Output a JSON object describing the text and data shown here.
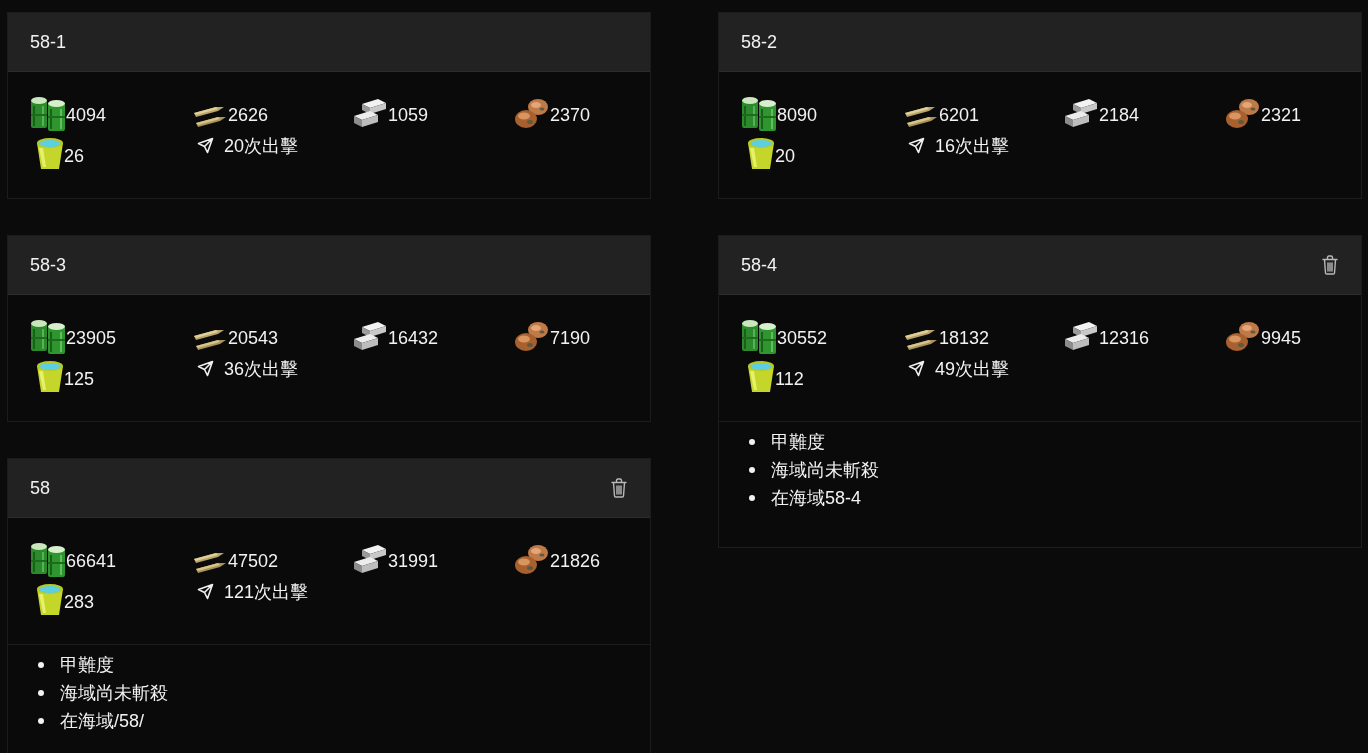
{
  "cards": [
    {
      "title": "58-1",
      "deletable": false,
      "resources": [
        {
          "kind": "fuel",
          "amount": "4094"
        },
        {
          "kind": "ammo",
          "amount": "2626"
        },
        {
          "kind": "steel",
          "amount": "1059"
        },
        {
          "kind": "bauxite",
          "amount": "2370"
        },
        {
          "kind": "bucket",
          "amount": "26"
        }
      ],
      "sorties": "20次出擊"
    },
    {
      "title": "58-2",
      "deletable": false,
      "resources": [
        {
          "kind": "fuel",
          "amount": "8090"
        },
        {
          "kind": "ammo",
          "amount": "6201"
        },
        {
          "kind": "steel",
          "amount": "2184"
        },
        {
          "kind": "bauxite",
          "amount": "2321"
        },
        {
          "kind": "bucket",
          "amount": "20"
        }
      ],
      "sorties": "16次出擊"
    },
    {
      "title": "58-3",
      "deletable": false,
      "resources": [
        {
          "kind": "fuel",
          "amount": "23905"
        },
        {
          "kind": "ammo",
          "amount": "20543"
        },
        {
          "kind": "steel",
          "amount": "16432"
        },
        {
          "kind": "bauxite",
          "amount": "7190"
        },
        {
          "kind": "bucket",
          "amount": "125"
        }
      ],
      "sorties": "36次出擊"
    },
    {
      "title": "58-4",
      "deletable": true,
      "resources": [
        {
          "kind": "fuel",
          "amount": "30552"
        },
        {
          "kind": "ammo",
          "amount": "18132"
        },
        {
          "kind": "steel",
          "amount": "12316"
        },
        {
          "kind": "bauxite",
          "amount": "9945"
        },
        {
          "kind": "bucket",
          "amount": "112"
        }
      ],
      "sorties": "49次出擊",
      "notes": [
        "甲難度",
        "海域尚未斬殺",
        "在海域58-4"
      ]
    },
    {
      "title": "58",
      "deletable": true,
      "resources": [
        {
          "kind": "fuel",
          "amount": "66641"
        },
        {
          "kind": "ammo",
          "amount": "47502"
        },
        {
          "kind": "steel",
          "amount": "31991"
        },
        {
          "kind": "bauxite",
          "amount": "21826"
        },
        {
          "kind": "bucket",
          "amount": "283"
        }
      ],
      "sorties": "121次出擊",
      "notes": [
        "甲難度",
        "海域尚未斬殺",
        "在海域/58/"
      ]
    }
  ]
}
